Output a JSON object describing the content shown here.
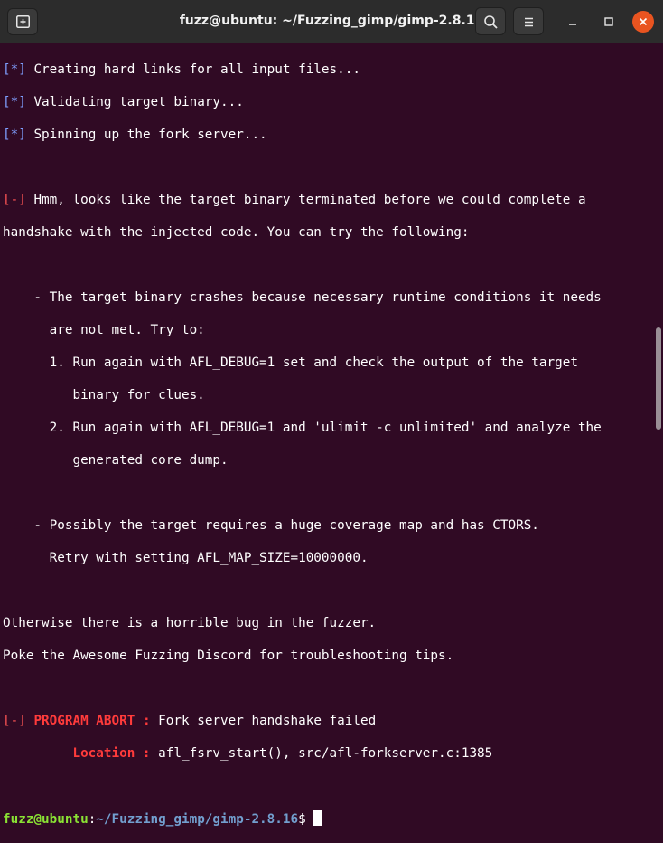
{
  "window": {
    "title": "fuzz@ubuntu: ~/Fuzzing_gimp/gimp-2.8.16",
    "buttons": {
      "new_tab_icon": "new-tab-icon",
      "search_icon": "search-icon",
      "menu_icon": "hamburger-menu-icon",
      "minimize_icon": "minimize-icon",
      "maximize_icon": "maximize-icon",
      "close_icon": "close-icon"
    }
  },
  "colors": {
    "background": "#300a24",
    "titlebar": "#2c2c2c",
    "close_button": "#e95420",
    "prompt_user": "#8ae234",
    "prompt_path": "#729fcf",
    "error": "#ff5555",
    "info_marker": "#7f9fff"
  },
  "terminal": {
    "info_marker": "[*]",
    "error_marker": "[-]",
    "lines": {
      "l1": "Creating hard links for all input files...",
      "l2": "Validating target binary...",
      "l3": "Spinning up the fork server...",
      "l5": "Hmm, looks like the target binary terminated before we could complete a",
      "l6": "handshake with the injected code. You can try the following:",
      "l8": "    - The target binary crashes because necessary runtime conditions it needs",
      "l9": "      are not met. Try to:",
      "l10": "      1. Run again with AFL_DEBUG=1 set and check the output of the target",
      "l11": "         binary for clues.",
      "l12": "      2. Run again with AFL_DEBUG=1 and 'ulimit -c unlimited' and analyze the",
      "l13": "         generated core dump.",
      "l15": "    - Possibly the target requires a huge coverage map and has CTORS.",
      "l16": "      Retry with setting AFL_MAP_SIZE=10000000.",
      "l18": "Otherwise there is a horrible bug in the fuzzer.",
      "l19": "Poke the Awesome Fuzzing Discord for troubleshooting tips."
    },
    "abort": {
      "label": "PROGRAM ABORT :",
      "message": "Fork server handshake failed",
      "location_label": "Location :",
      "location_value": "afl_fsrv_start(), src/afl-forkserver.c:1385"
    },
    "prompt": {
      "user": "fuzz@ubuntu",
      "separator": ":",
      "path": "~/Fuzzing_gimp/gimp-2.8.16",
      "symbol": "$"
    }
  }
}
